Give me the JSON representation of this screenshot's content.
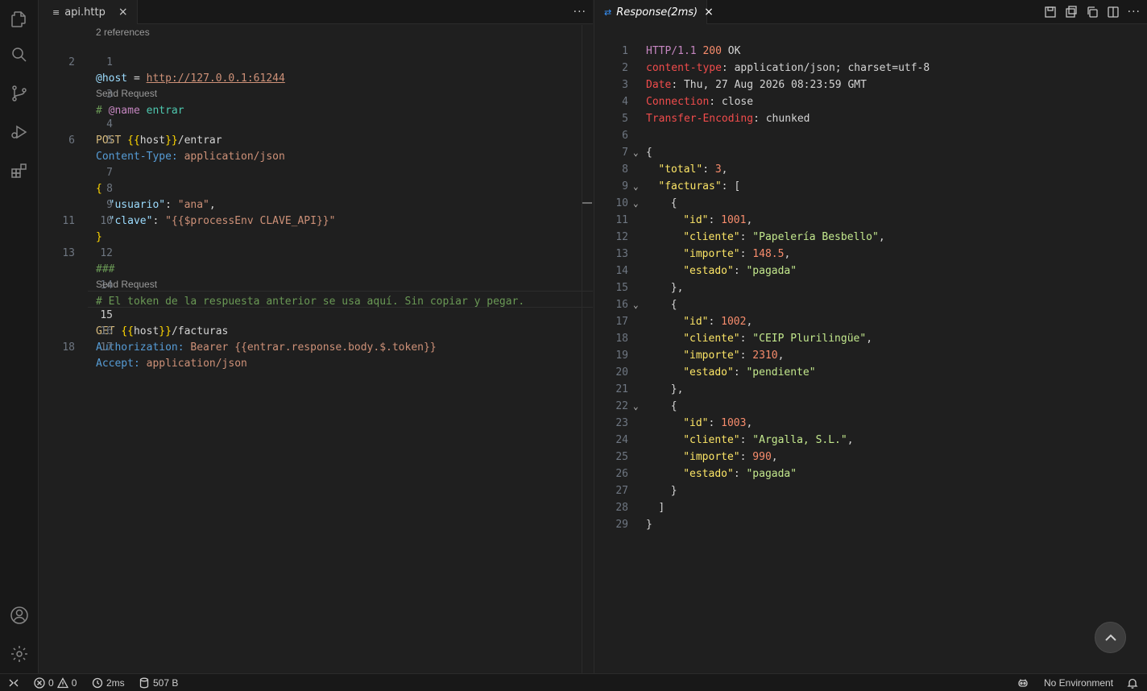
{
  "left_tab": {
    "label": "api.http",
    "close": "×"
  },
  "right_tab": {
    "label": "Response(2ms)",
    "close": "×"
  },
  "more": "···",
  "lenses": {
    "references": "2 references",
    "send_request_1": "Send Request",
    "send_request_2": "Send Request"
  },
  "request": {
    "l1": {
      "n": "1",
      "var": "@host",
      "eq": " = ",
      "url": "http://127.0.0.1:61244"
    },
    "l2": {
      "n": "2"
    },
    "l3": {
      "n": "3",
      "hash": "# ",
      "kw": "@name",
      "name": " entrar"
    },
    "l4": {
      "n": "4",
      "method": "POST ",
      "b1": "{{",
      "host": "host",
      "b2": "}}",
      "path": "/entrar"
    },
    "l5": {
      "n": "5",
      "hname": "Content-Type:",
      "hval": " application/json"
    },
    "l6": {
      "n": "6"
    },
    "l7": {
      "n": "7",
      "brace": "{"
    },
    "l8": {
      "n": "8",
      "key": "  \"usuario\"",
      "colon": ": ",
      "val": "\"ana\"",
      "comma": ","
    },
    "l9": {
      "n": "9",
      "key": "  \"clave\"",
      "colon": ": ",
      "val": "\"{{$processEnv CLAVE_API}}\""
    },
    "l10": {
      "n": "10",
      "brace": "}"
    },
    "l11": {
      "n": "11"
    },
    "l12": {
      "n": "12",
      "sep": "###"
    },
    "l13": {
      "n": "13"
    },
    "l14": {
      "n": "14",
      "comment": "# El token de la respuesta anterior se usa aquí. Sin copiar y pegar."
    },
    "l15": {
      "n": "15",
      "method": "GET ",
      "b1": "{{",
      "host": "host",
      "b2": "}}",
      "path": "/facturas"
    },
    "l16": {
      "n": "16",
      "hname": "Authorization:",
      "hval": " Bearer {{entrar.response.body.$.token}}"
    },
    "l17": {
      "n": "17",
      "hname": "Accept:",
      "hval": " application/json"
    },
    "l18": {
      "n": "18"
    }
  },
  "response": {
    "l1": {
      "n": "1",
      "proto": "HTTP/1.1 ",
      "code": "200",
      "ok": " OK"
    },
    "l2": {
      "n": "2",
      "h": "content-type",
      "v": ": application/json; charset=utf-8"
    },
    "l3": {
      "n": "3",
      "h": "Date",
      "v": ": Thu, 27 Aug 2026 08:23:59 GMT"
    },
    "l4": {
      "n": "4",
      "h": "Connection",
      "v": ": close"
    },
    "l5": {
      "n": "5",
      "h": "Transfer-Encoding",
      "v": ": chunked"
    },
    "l6": {
      "n": "6"
    },
    "l7": {
      "n": "7",
      "t": "{"
    },
    "l8": {
      "n": "8",
      "k": "\"total\"",
      "c": ": ",
      "v": "3",
      "e": ","
    },
    "l9": {
      "n": "9",
      "k": "\"facturas\"",
      "c": ": ["
    },
    "l10": {
      "n": "10",
      "t": "{"
    },
    "l11": {
      "n": "11",
      "k": "\"id\"",
      "c": ": ",
      "v": "1001",
      "e": ","
    },
    "l12": {
      "n": "12",
      "k": "\"cliente\"",
      "c": ": ",
      "v": "\"Papelería Besbello\"",
      "e": ","
    },
    "l13": {
      "n": "13",
      "k": "\"importe\"",
      "c": ": ",
      "v": "148.5",
      "e": ","
    },
    "l14": {
      "n": "14",
      "k": "\"estado\"",
      "c": ": ",
      "v": "\"pagada\""
    },
    "l15": {
      "n": "15",
      "t": "},"
    },
    "l16": {
      "n": "16",
      "t": "{"
    },
    "l17": {
      "n": "17",
      "k": "\"id\"",
      "c": ": ",
      "v": "1002",
      "e": ","
    },
    "l18": {
      "n": "18",
      "k": "\"cliente\"",
      "c": ": ",
      "v": "\"CEIP Plurilingüe\"",
      "e": ","
    },
    "l19": {
      "n": "19",
      "k": "\"importe\"",
      "c": ": ",
      "v": "2310",
      "e": ","
    },
    "l20": {
      "n": "20",
      "k": "\"estado\"",
      "c": ": ",
      "v": "\"pendiente\""
    },
    "l21": {
      "n": "21",
      "t": "},"
    },
    "l22": {
      "n": "22",
      "t": "{"
    },
    "l23": {
      "n": "23",
      "k": "\"id\"",
      "c": ": ",
      "v": "1003",
      "e": ","
    },
    "l24": {
      "n": "24",
      "k": "\"cliente\"",
      "c": ": ",
      "v": "\"Argalla, S.L.\"",
      "e": ","
    },
    "l25": {
      "n": "25",
      "k": "\"importe\"",
      "c": ": ",
      "v": "990",
      "e": ","
    },
    "l26": {
      "n": "26",
      "k": "\"estado\"",
      "c": ": ",
      "v": "\"pagada\""
    },
    "l27": {
      "n": "27",
      "t": "}"
    },
    "l28": {
      "n": "28",
      "t": "]"
    },
    "l29": {
      "n": "29",
      "t": "}"
    }
  },
  "status": {
    "errors": "0",
    "warnings": "0",
    "duration": "2ms",
    "size": "507 B",
    "environment": "No Environment"
  },
  "icons": {
    "activity": [
      "explorer-icon",
      "search-icon",
      "source-control-icon",
      "run-debug-icon",
      "extensions-icon",
      "account-icon",
      "manage-gear-icon"
    ]
  }
}
